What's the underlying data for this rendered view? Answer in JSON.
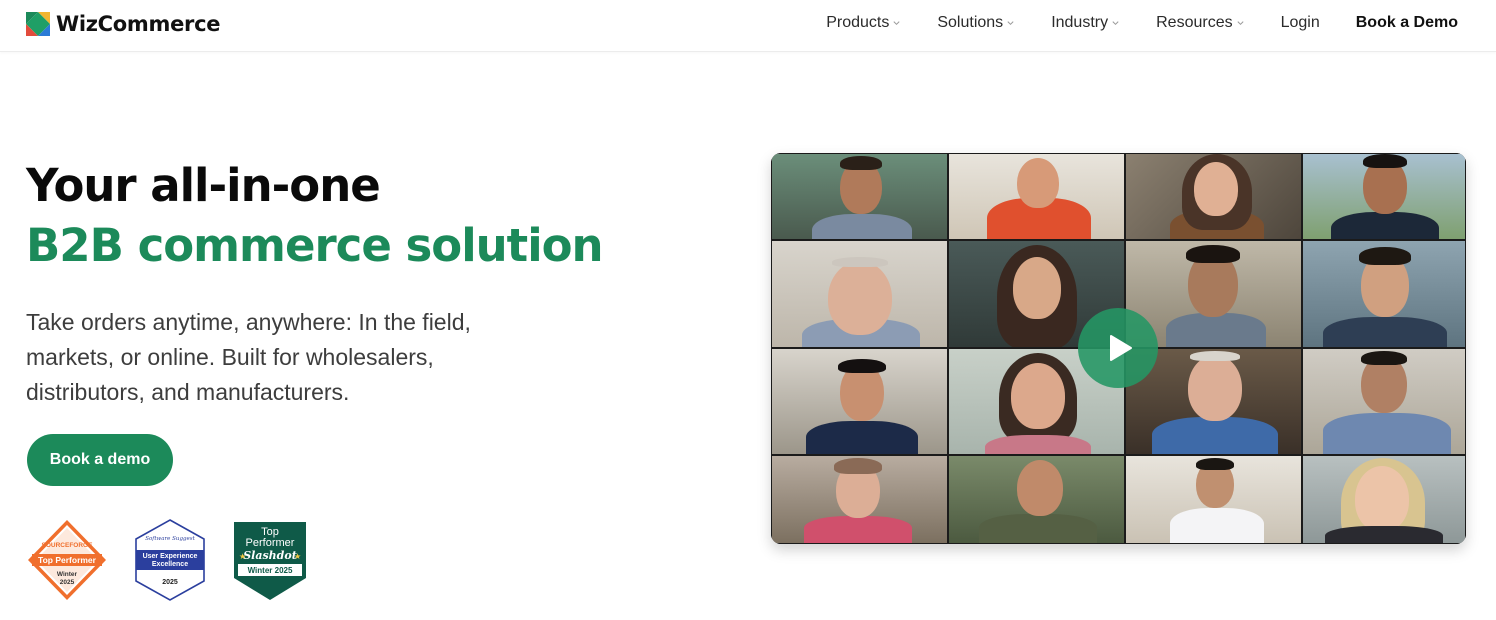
{
  "brand": {
    "name": "WizCommerce"
  },
  "nav": {
    "items": [
      {
        "label": "Products",
        "dropdown": true
      },
      {
        "label": "Solutions",
        "dropdown": true
      },
      {
        "label": "Industry",
        "dropdown": true
      },
      {
        "label": "Resources",
        "dropdown": true
      },
      {
        "label": "Login",
        "dropdown": false
      },
      {
        "label": "Book a Demo",
        "dropdown": false
      }
    ]
  },
  "hero": {
    "title_line1": "Your all-in-one",
    "title_line2": "B2B commerce solution",
    "subtitle_line1": "Take orders anytime, anywhere: In the field,",
    "subtitle_line2": "markets, or online. Built for wholesalers,",
    "subtitle_line3": "distributors, and manufacturers.",
    "cta_label": "Book a demo"
  },
  "badges": [
    {
      "source": "SOURCEFORGE",
      "title": "Top Performer",
      "period": "Winter",
      "year": "2025",
      "color": "#f06f2d"
    },
    {
      "source": "Software Suggest",
      "title_l1": "User Experience",
      "title_l2": "Excellence",
      "year": "2025",
      "color": "#2b3f9e"
    },
    {
      "title_l1": "Top",
      "title_l2": "Performer",
      "source": "Slashdot",
      "period": "Winter 2025",
      "color": "#0f5a48"
    }
  ],
  "video": {
    "play_icon": "play-icon",
    "accent": "#1c8a5a"
  },
  "colors": {
    "brand_green": "#1c8a5a",
    "text_dark": "#0a0a0a",
    "text_body": "#3d3d3d"
  }
}
